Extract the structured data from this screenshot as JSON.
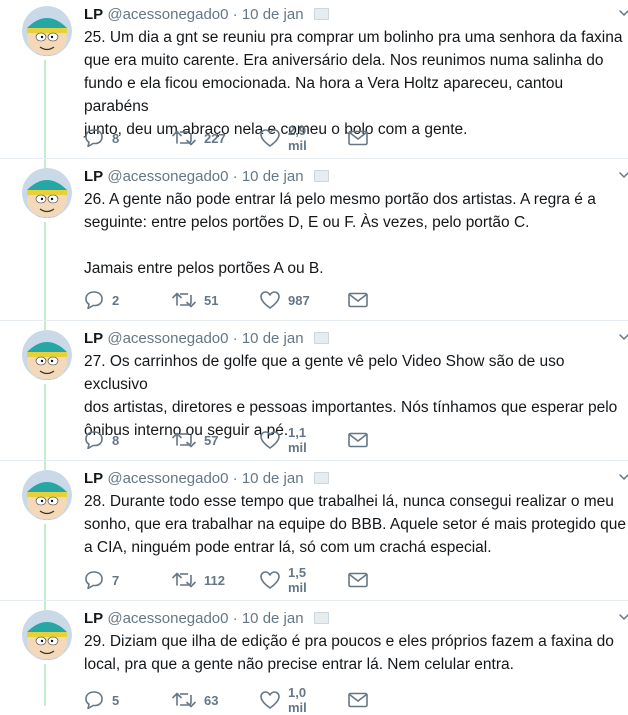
{
  "tweets": [
    {
      "name": "LP",
      "handle": "@acessonegado0",
      "sep": "·",
      "date": "10 de jan",
      "text": "25. Um dia a gnt se reuniu pra comprar um bolinho pra uma senhora da faxina\nque era muito carente. Era aniversário dela. Nos reunimos numa salinha do\nfundo e ela ficou emocionada. Na hora a Vera Holtz apareceu, cantou parabéns\njunto, deu um abraço nela e comeu o bolo com a gente.",
      "replies": "8",
      "retweets": "227",
      "likes": "2,9 mil"
    },
    {
      "name": "LP",
      "handle": "@acessonegado0",
      "sep": "·",
      "date": "10 de jan",
      "text": "26. A gente não pode entrar lá pelo mesmo portão dos artistas. A regra é a\nseguinte: entre pelos portões D, E ou F. Às vezes, pelo portão C.\n\nJamais entre pelos portões A ou B.",
      "replies": "2",
      "retweets": "51",
      "likes": "987"
    },
    {
      "name": "LP",
      "handle": "@acessonegado0",
      "sep": "·",
      "date": "10 de jan",
      "text": "27. Os carrinhos de golfe que a gente vê pelo Video Show são de uso exclusivo\ndos artistas, diretores e pessoas importantes. Nós tínhamos que esperar pelo\nônibus interno ou seguir a pé.",
      "replies": "8",
      "retweets": "57",
      "likes": "1,1 mil"
    },
    {
      "name": "LP",
      "handle": "@acessonegado0",
      "sep": "·",
      "date": "10 de jan",
      "text": "28. Durante todo esse tempo que trabalhei lá, nunca consegui realizar o meu\nsonho, que era trabalhar na equipe do BBB. Aquele setor é mais protegido que\na CIA, ninguém pode entrar lá, só com um crachá especial.",
      "replies": "7",
      "retweets": "112",
      "likes": "1,5 mil"
    },
    {
      "name": "LP",
      "handle": "@acessonegado0",
      "sep": "·",
      "date": "10 de jan",
      "text": "29. Diziam que ilha de edição é pra poucos e eles próprios fazem a faxina do\nlocal, pra que a gente não precise entrar lá. Nem celular entra.",
      "replies": "5",
      "retweets": "63",
      "likes": "1,0 mil"
    }
  ],
  "colors": {
    "text": "#14171a",
    "secondary": "#657786",
    "thread_line": "#c4eec5",
    "divider": "#e6ecf0"
  },
  "icons": [
    "avatar-cartman",
    "verified-placeholder-icon",
    "chevron-down-icon",
    "reply-icon",
    "retweet-icon",
    "like-icon",
    "dm-icon"
  ]
}
